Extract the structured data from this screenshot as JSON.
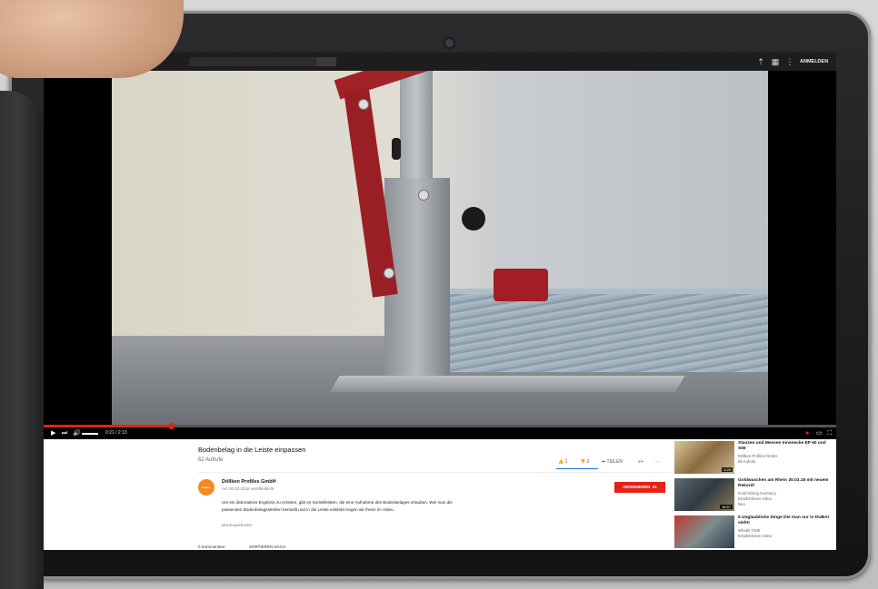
{
  "topbar": {
    "signin_label": "ANMELDEN",
    "icons": [
      "upload-icon",
      "apps-grid-icon",
      "more-vert-icon"
    ]
  },
  "player": {
    "time": "0:21 / 2:13",
    "progress": 0.16
  },
  "video": {
    "title": "Bodenbelag in die Leiste einpassen",
    "views": "62 Aufrufe",
    "likes": "1",
    "dislikes": "0",
    "share_label": "TEILEN",
    "channel": {
      "name": "Döllken Profiles GmbH",
      "avatar_text": "Döllken",
      "published": "Am 20.02.2018 veröffentlicht"
    },
    "subscribe_label": "ABONNIEREN",
    "subscriber_count": "51",
    "description": "Um ein dekoratives Ergebnis zu erzielen, gibt es Sockelleisten, die eine Aufnahme des Bodenbelages erlauben. Wie man die passenden Bodenbelagsstreifen herstellt und in die Leiste einklebt zeigen wir Ihnen im Video.",
    "more_label": "MEHR ANZEIGEN",
    "comments_label": "0 Kommentare",
    "sort_label": "SORTIEREN NACH"
  },
  "recommendations": [
    {
      "title": "Stanzen und Messen Innenecke EP 60 und S66",
      "channel": "Döllken Profiles GmbH",
      "meta": "58 Aufrufe",
      "duration": "1:29"
    },
    {
      "title": "Goldwaschen am Rhein 30.03.18 mit neuem Rekord!",
      "channel": "Gold Mining Germany",
      "meta": "Empfohlenes Video",
      "extra": "Neu",
      "duration": "16:57"
    },
    {
      "title": "5 Unglaubliche Dinge Die man nur in DUBAI sieht!",
      "channel": "Whatik TIME",
      "meta": "Empfohlenes Video",
      "duration": ""
    }
  ]
}
